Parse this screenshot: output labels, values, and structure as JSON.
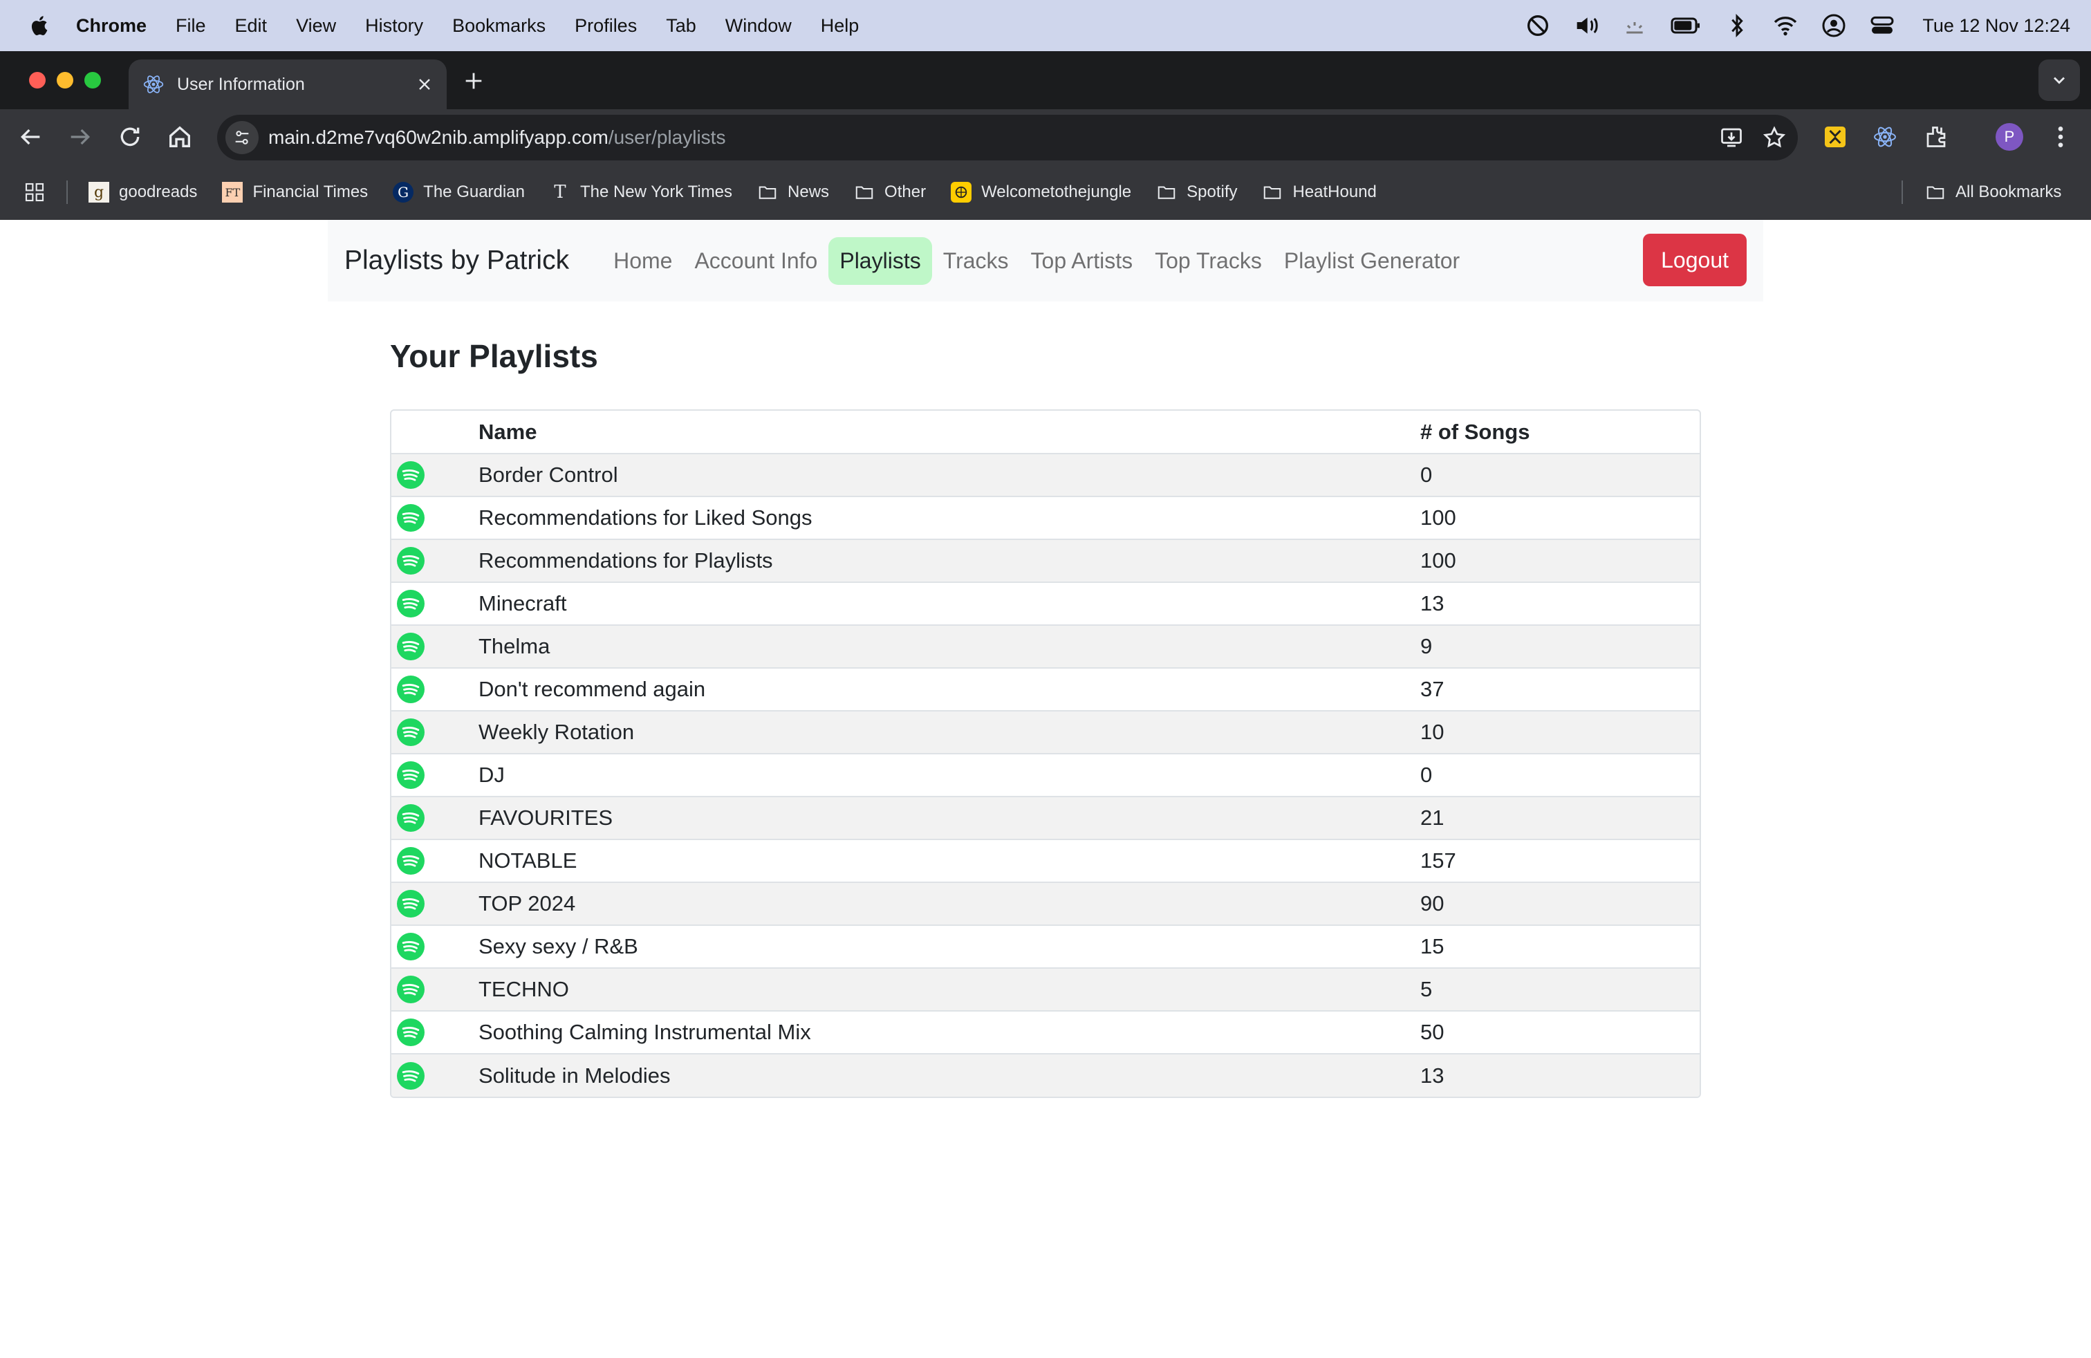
{
  "menubar": {
    "app": "Chrome",
    "items": [
      "File",
      "Edit",
      "View",
      "History",
      "Bookmarks",
      "Profiles",
      "Tab",
      "Window",
      "Help"
    ],
    "clock": "Tue 12 Nov  12:24"
  },
  "browser": {
    "tab_title": "User Information",
    "url_host": "main.d2me7vq60w2nib.amplifyapp.com",
    "url_path": "/user/playlists",
    "profile_initial": "P",
    "bookmarks": [
      "goodreads",
      "Financial Times",
      "The Guardian",
      "The New York Times",
      "News",
      "Other",
      "Welcometothejungle",
      "Spotify",
      "HeatHound"
    ],
    "all_bookmarks": "All Bookmarks"
  },
  "navbar": {
    "brand": "Playlists by Patrick",
    "links": [
      "Home",
      "Account Info",
      "Playlists",
      "Tracks",
      "Top Artists",
      "Top Tracks",
      "Playlist Generator"
    ],
    "active": "Playlists",
    "logout": "Logout"
  },
  "page": {
    "heading": "Your Playlists",
    "columns": [
      "",
      "Name",
      "# of Songs"
    ],
    "playlists": [
      {
        "name": "Border Control",
        "songs": "0"
      },
      {
        "name": "Recommendations for Liked Songs",
        "songs": "100"
      },
      {
        "name": "Recommendations for Playlists",
        "songs": "100"
      },
      {
        "name": "Minecraft",
        "songs": "13"
      },
      {
        "name": "Thelma",
        "songs": "9"
      },
      {
        "name": "Don't recommend again",
        "songs": "37"
      },
      {
        "name": "Weekly Rotation",
        "songs": "10"
      },
      {
        "name": "DJ",
        "songs": "0"
      },
      {
        "name": "FAVOURITES",
        "songs": "21"
      },
      {
        "name": "NOTABLE",
        "songs": "157"
      },
      {
        "name": "TOP 2024",
        "songs": "90"
      },
      {
        "name": "Sexy sexy / R&B",
        "songs": "15"
      },
      {
        "name": "TECHNO",
        "songs": "5"
      },
      {
        "name": "Soothing Calming Instrumental Mix",
        "songs": "50"
      },
      {
        "name": "Solitude in Melodies",
        "songs": "13"
      }
    ]
  },
  "colors": {
    "spotify_green": "#1ed760",
    "active_tab": "#bff7c8",
    "logout": "#dc3545"
  }
}
